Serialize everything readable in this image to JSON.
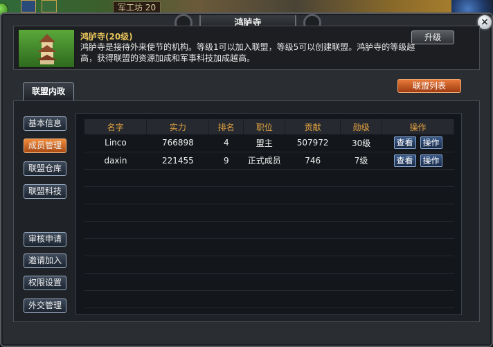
{
  "scene": {
    "badge": "军工坊 20",
    "colors": {
      "accent": "#e0a040",
      "active": "#f08a3a"
    }
  },
  "window": {
    "title": "鸿胪寺",
    "close_icon": "close-icon"
  },
  "building": {
    "title": "鸿胪寺(20级)",
    "description": "鸿胪寺是接待外来使节的机构。等级1可以加入联盟，等级5可以创建联盟。鸿胪寺的等级越高，获得联盟的资源加成和军事科技加成越高。",
    "upgrade_label": "升级",
    "thumbnail_icon": "pagoda-icon"
  },
  "tabs": {
    "main_tab": "联盟内政",
    "list_button": "联盟列表"
  },
  "sidebar": {
    "items": [
      {
        "label": "基本信息",
        "active": false
      },
      {
        "label": "成员管理",
        "active": true
      },
      {
        "label": "联盟仓库",
        "active": false
      },
      {
        "label": "联盟科技",
        "active": false
      },
      {
        "label": "审核申请",
        "active": false
      },
      {
        "label": "邀请加入",
        "active": false
      },
      {
        "label": "权限设置",
        "active": false
      },
      {
        "label": "外交管理",
        "active": false
      }
    ]
  },
  "table": {
    "headers": [
      "名字",
      "实力",
      "排名",
      "职位",
      "贡献",
      "勋级",
      "操作"
    ],
    "view_label": "查看",
    "operate_label": "操作",
    "rows": [
      {
        "name": "Linco",
        "power": "766898",
        "rank": "4",
        "position": "盟主",
        "contribution": "507972",
        "medal": "30级"
      },
      {
        "name": "daxin",
        "power": "221455",
        "rank": "9",
        "position": "正式成员",
        "contribution": "746",
        "medal": "7级"
      }
    ]
  }
}
